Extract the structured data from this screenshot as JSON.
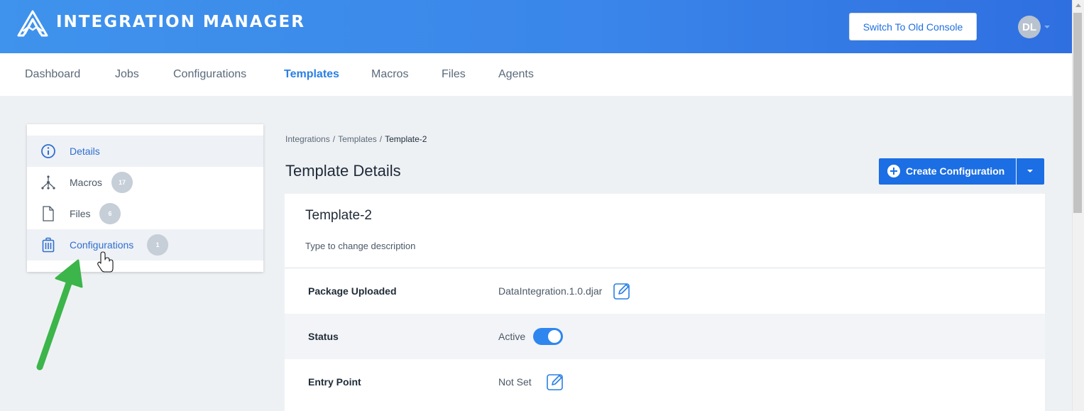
{
  "header": {
    "brand": "INTEGRATION MANAGER",
    "old_console_label": "Switch To Old Console",
    "avatar_initials": "DL"
  },
  "nav": {
    "items": [
      "Dashboard",
      "Jobs",
      "Configurations",
      "Templates",
      "Macros",
      "Files",
      "Agents"
    ],
    "active": "Templates"
  },
  "sidebar": {
    "items": [
      {
        "label": "Details",
        "icon": "info-icon",
        "badge": ""
      },
      {
        "label": "Macros",
        "icon": "flow-icon",
        "badge": "17"
      },
      {
        "label": "Files",
        "icon": "file-icon",
        "badge": "6"
      },
      {
        "label": "Configurations",
        "icon": "briefcase-icon",
        "badge": "1"
      }
    ]
  },
  "breadcrumb": [
    "Integrations",
    "Templates",
    "Template-2"
  ],
  "page": {
    "title": "Template Details",
    "create_label": "Create Configuration"
  },
  "template": {
    "name": "Template-2",
    "description": "Type to change description",
    "fields": [
      {
        "label": "Package Uploaded",
        "value": "DataIntegration.1.0.djar"
      },
      {
        "label": "Status",
        "value": "Active"
      },
      {
        "label": "Entry Point",
        "value": "Not Set"
      }
    ]
  },
  "colors": {
    "accent": "#1b6ee3",
    "header_gradient_start": "#3f93ec",
    "annotation_arrow": "#3cb54a"
  }
}
